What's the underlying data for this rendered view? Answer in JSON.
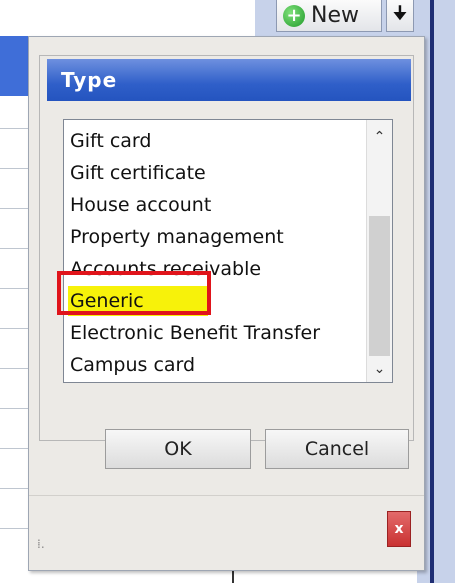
{
  "toolbar": {
    "new_label": "New",
    "new_icon": "plus-icon",
    "dropdown_icon": "down-arrow-icon"
  },
  "dialog": {
    "title": "Type",
    "items": [
      "Gift card",
      "Gift certificate",
      "House account",
      "Property management",
      "Accounts receivable",
      "Generic",
      "Electronic Benefit Transfer",
      "Campus card"
    ],
    "selected_item": "Generic",
    "ok_label": "OK",
    "cancel_label": "Cancel",
    "close_glyph": "x",
    "grip_glyph": "⁞."
  },
  "colors": {
    "header_blue": "#2f5fc9",
    "selection_yellow": "#f7f20a",
    "highlight_red": "#e0141b",
    "close_red": "#c93232"
  }
}
